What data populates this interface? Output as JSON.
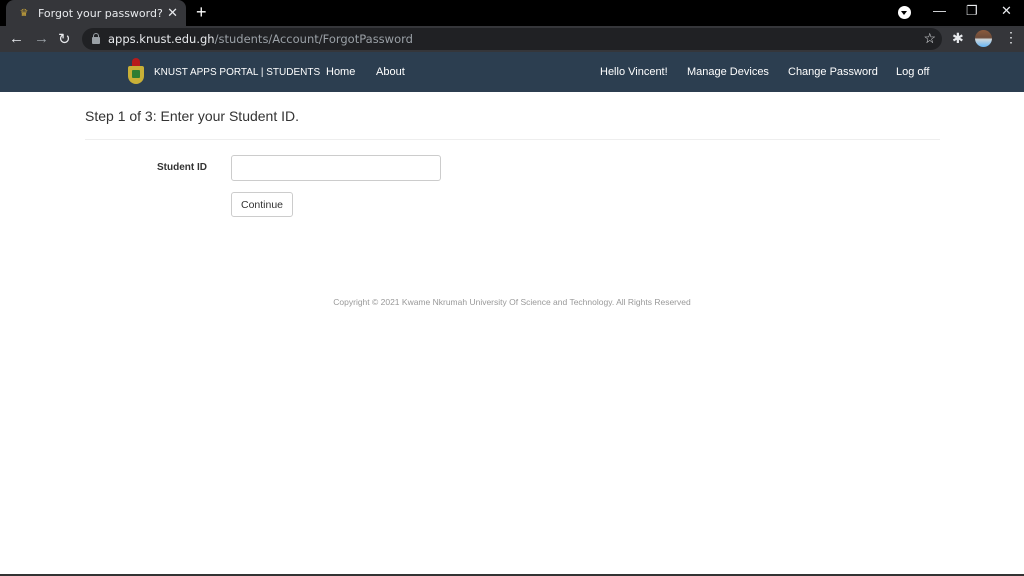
{
  "browser": {
    "tab": {
      "title": "Forgot your password?",
      "favicon": "knust-crest-icon",
      "close_glyph": "✕"
    },
    "new_tab_glyph": "+",
    "window_controls": {
      "minimize": "—",
      "restore": "❐",
      "close": "✕"
    },
    "nav": {
      "back": "←",
      "forward": "→",
      "reload": "↻"
    },
    "url": {
      "host": "apps.knust.edu.gh",
      "path": "/students/Account/ForgotPassword"
    },
    "bookmark_glyph": "☆",
    "extensions_glyph": "✱",
    "menu_glyph": "⋮"
  },
  "navbar": {
    "brand": "KNUST APPS PORTAL | STUDENTS",
    "left_links": [
      "Home",
      "About"
    ],
    "right_links": [
      "Hello Vincent!",
      "Manage Devices",
      "Change Password",
      "Log off"
    ],
    "background": "#2c3e50"
  },
  "main": {
    "heading": "Step 1 of 3: Enter your Student ID.",
    "form": {
      "student_id_label": "Student ID",
      "student_id_value": "",
      "continue_label": "Continue"
    }
  },
  "footer": {
    "copyright": "Copyright © 2021 Kwame Nkrumah University Of Science and Technology. All Rights Reserved"
  }
}
